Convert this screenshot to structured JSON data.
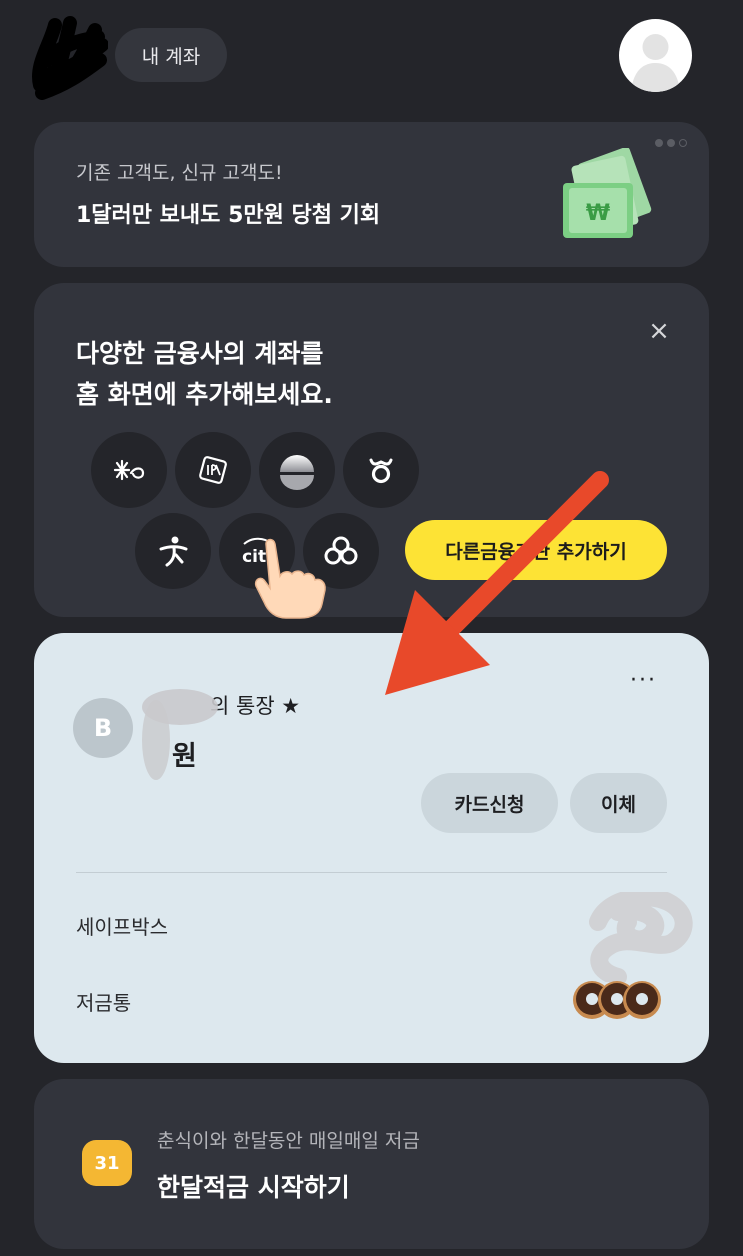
{
  "header": {
    "account_tab": "내 계좌"
  },
  "promo": {
    "subtitle": "기존 고객도, 신규 고객도!",
    "title": "1달러만 보내도 5만원 당첨 기회",
    "money_symbol": "₩"
  },
  "add_accounts": {
    "title_line1": "다양한 금융사의 계좌를",
    "title_line2": "홈 화면에 추가해보세요.",
    "close": "×",
    "citi_text": "citi",
    "button": "다른금융기관 추가하기"
  },
  "account": {
    "name": "의 통장 ★",
    "balance": "원",
    "more": "···",
    "logo": "B",
    "card_button": "카드신청",
    "transfer_button": "이체",
    "rows": [
      {
        "label": "세이프박스"
      },
      {
        "label": "저금통"
      }
    ]
  },
  "saving": {
    "badge": "31",
    "subtitle": "춘식이와 한달동안 매일매일 저금",
    "title": "한달적금 시작하기"
  },
  "colors": {
    "background": "#24252a",
    "card": "#32343c",
    "account_card": "#dde8ee",
    "accent_yellow": "#fde335",
    "arrow": "#e8492a"
  }
}
